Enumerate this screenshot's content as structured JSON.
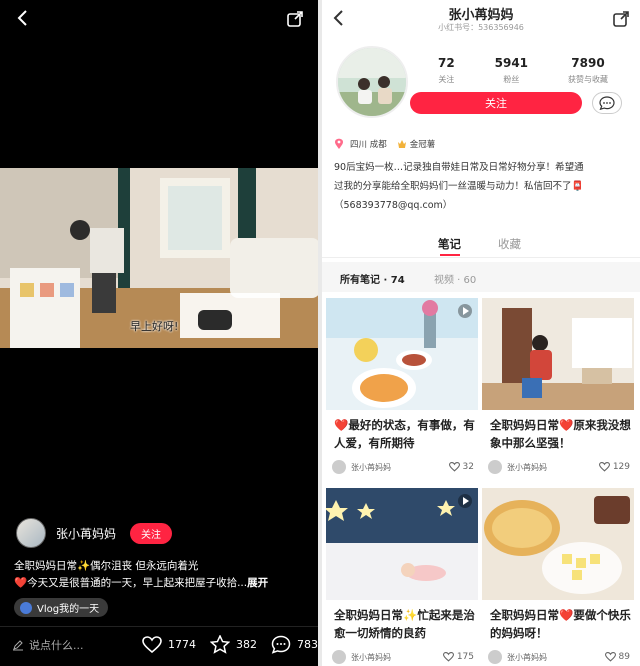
{
  "video_view": {
    "caption": "早上好呀!",
    "author_name": "张小苒妈妈",
    "follow_label": "关注",
    "desc_line1": "全职妈妈日常✨偶尔沮丧 但永远向着光",
    "desc_line2_text": "❤️今天又是很普通的一天，早上起来把屋子收拾...",
    "desc_expand": "展开",
    "tag": "Vlog我的一天",
    "comment_placeholder": "说点什么...",
    "like_count": "1774",
    "collect_count": "382",
    "comment_count": "783",
    "colors": {
      "accent": "#ff2442",
      "background": "#000000"
    }
  },
  "profile": {
    "name": "张小苒妈妈",
    "id_line": "小红书号：536356946",
    "stats": [
      {
        "num": "72",
        "label": "关注"
      },
      {
        "num": "5941",
        "label": "粉丝"
      },
      {
        "num": "7890",
        "label": "获赞与收藏"
      }
    ],
    "follow_label": "关注",
    "location": "四川 成都",
    "award": "金冠薯",
    "bio_line1": "90后宝妈一枚…记录独自带娃日常及日常好物分享！希望通",
    "bio_line2": "过我的分享能给全职妈妈们一丝温暖与动力！私信回不了📮",
    "bio_line3": "（568393778@qq.com）",
    "tabs": [
      "笔记",
      "收藏"
    ],
    "filters": [
      "所有笔记 · 74",
      "视频 · 60"
    ],
    "cards": [
      {
        "title": "❤️最好的状态，有事做，有人爱，有所期待",
        "author": "张小苒妈妈",
        "likes": "32"
      },
      {
        "title": "全职妈妈日常❤️原来我没想象中那么坚强！",
        "author": "张小苒妈妈",
        "likes": "129"
      },
      {
        "title": "全职妈妈日常✨忙起来是治愈一切矫情的良药",
        "author": "张小苒妈妈",
        "likes": "175"
      },
      {
        "title": "全职妈妈日常❤️要做个快乐的妈妈呀！",
        "author": "张小苒妈妈",
        "likes": "89"
      }
    ],
    "icons": [
      "back-icon",
      "share-icon",
      "message-icon",
      "location-icon",
      "award-icon",
      "heart-icon",
      "star-icon",
      "comment-icon",
      "pencil-icon",
      "play-icon"
    ]
  }
}
